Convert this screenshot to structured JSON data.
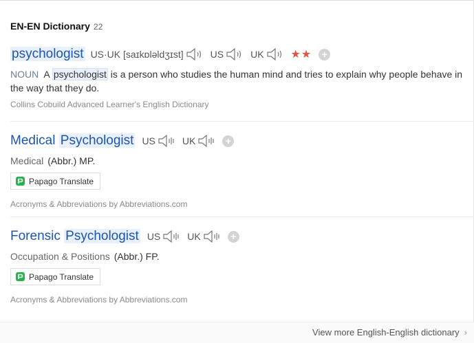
{
  "header": {
    "title": "EN-EN Dictionary",
    "count": "22"
  },
  "entries": [
    {
      "headword": "psychologist",
      "pron_label": "US·UK [saɪkɒləldʒɪst]",
      "us_label": "US",
      "uk_label": "UK",
      "stars": "★★",
      "pos": "NOUN",
      "def_pre": "A",
      "def_word": "psychologist",
      "def_post": "is a person who studies the human mind and tries to explain why people behave in the way that they do.",
      "source": "Collins Cobuild Advanced Learner's English Dictionary"
    },
    {
      "headword_pre": "Medical",
      "headword_hl": "Psychologist",
      "us_label": "US",
      "uk_label": "UK",
      "category": "Medical",
      "abbr": "(Abbr.) MP.",
      "translate_label": "Papago Translate",
      "source": "Acronyms & Abbreviations by Abbreviations.com"
    },
    {
      "headword_pre": "Forensic",
      "headword_hl": "Psychologist",
      "us_label": "US",
      "uk_label": "UK",
      "category": "Occupation & Positions",
      "abbr": "(Abbr.) FP.",
      "translate_label": "Papago Translate",
      "source": "Acronyms & Abbreviations by Abbreviations.com"
    }
  ],
  "footer": {
    "more_label": "View more English-English dictionary",
    "chevron": "›"
  },
  "icons": {
    "speaker": "speaker-icon",
    "add": "plus-icon",
    "papago": "papago-icon"
  },
  "colors": {
    "headword": "#1c54b0",
    "highlight": "#e8f1fb",
    "stars": "#e0533f",
    "pos": "#6b7f97"
  }
}
